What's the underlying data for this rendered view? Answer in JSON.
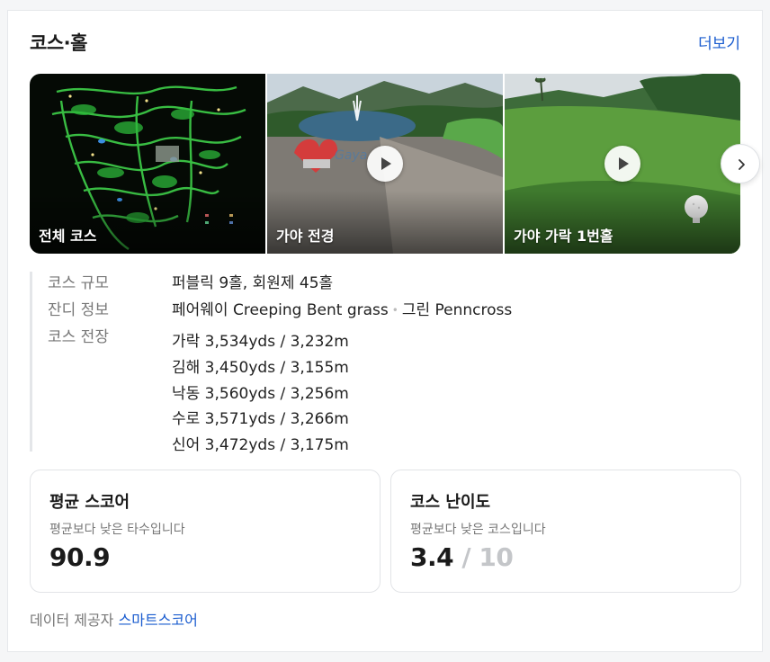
{
  "section": {
    "title": "코스·홀",
    "more_label": "더보기"
  },
  "gallery": {
    "items": [
      {
        "caption": "전체 코스",
        "type": "image"
      },
      {
        "caption": "가야 전경",
        "type": "video"
      },
      {
        "caption": "가야 가락 1번홀",
        "type": "video"
      }
    ],
    "next_icon": "chevron-right-icon",
    "play_icon": "play-icon"
  },
  "course_info": {
    "scale_label": "코스 규모",
    "scale_value": "퍼블릭 9홀, 회원제 45홀",
    "grass_label": "잔디 정보",
    "grass_fairway": "페어웨이 Creeping Bent grass",
    "grass_separator": "•",
    "grass_green": "그린 Penncross",
    "length_label": "코스 전장",
    "lengths": [
      "가락 3,534yds / 3,232m",
      "김해 3,450yds / 3,155m",
      "낙동 3,560yds / 3,256m",
      "수로 3,571yds / 3,266m",
      "신어 3,472yds / 3,175m"
    ]
  },
  "stats": {
    "avg_score": {
      "title": "평균 스코어",
      "subtitle": "평균보다 낮은 타수입니다",
      "value": "90.9"
    },
    "difficulty": {
      "title": "코스 난이도",
      "subtitle": "평균보다 낮은 코스입니다",
      "value": "3.4",
      "separator": "/",
      "max": "10"
    }
  },
  "provider": {
    "label": "데이터 제공자",
    "name": "스마트스코어"
  },
  "colors": {
    "link": "#1a5ccf",
    "course_map_bg": "#050a05",
    "fairway_green": "#3f7a2e"
  }
}
